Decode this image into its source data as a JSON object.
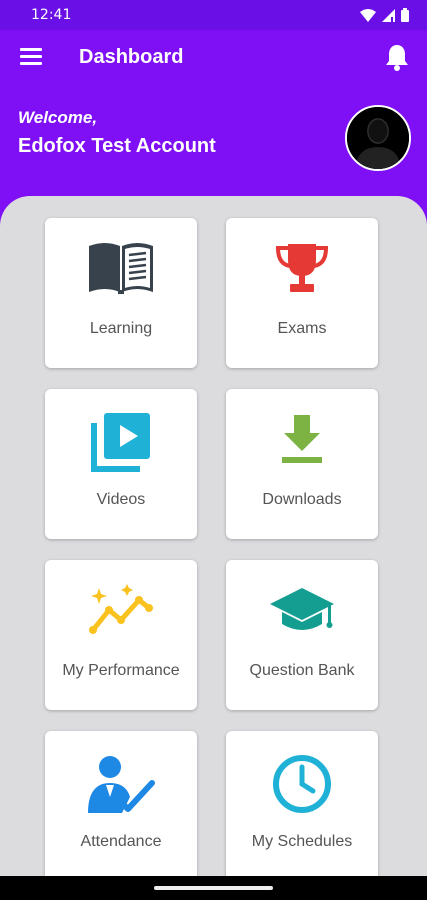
{
  "status": {
    "time": "12:41"
  },
  "header": {
    "title": "Dashboard",
    "welcome": "Welcome,",
    "account_name": "Edofox Test Account"
  },
  "tiles": [
    {
      "label": "Learning",
      "icon": "open-book-icon"
    },
    {
      "label": "Exams",
      "icon": "trophy-icon"
    },
    {
      "label": "Videos",
      "icon": "video-library-icon"
    },
    {
      "label": "Downloads",
      "icon": "download-icon"
    },
    {
      "label": "My Performance",
      "icon": "performance-chart-icon"
    },
    {
      "label": "Question Bank",
      "icon": "graduation-cap-icon"
    },
    {
      "label": "Attendance",
      "icon": "attendance-user-check-icon"
    },
    {
      "label": "My Schedules",
      "icon": "clock-icon"
    }
  ],
  "colors": {
    "header": "#7f10f5",
    "statusbar": "#6a0fe6",
    "background": "#dcdcdf",
    "trophy": "#e53935",
    "video": "#1fb1d6",
    "download": "#7cb342",
    "performance": "#f9c21e",
    "cap": "#149e91",
    "attendance": "#1e88e5",
    "book": "#37424d"
  }
}
